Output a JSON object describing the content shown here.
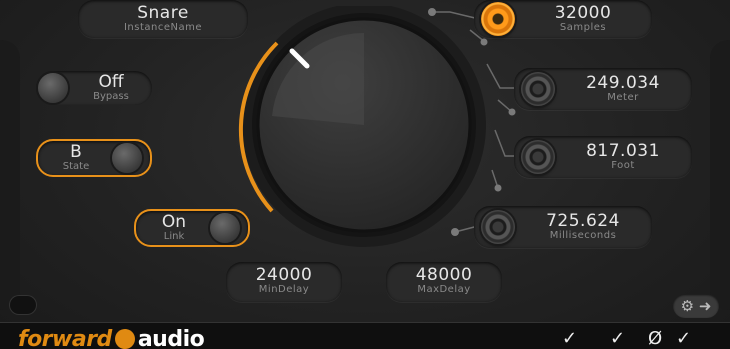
{
  "instance": {
    "value": "Snare",
    "label": "InstanceName"
  },
  "bypass": {
    "value": "Off",
    "label": "Bypass"
  },
  "state": {
    "value": "B",
    "label": "State"
  },
  "link": {
    "value": "On",
    "label": "Link"
  },
  "min_delay": {
    "value": "24000",
    "label": "MinDelay"
  },
  "max_delay": {
    "value": "48000",
    "label": "MaxDelay"
  },
  "samples": {
    "value": "32000",
    "label": "Samples"
  },
  "meter": {
    "value": "249.034",
    "label": "Meter"
  },
  "foot": {
    "value": "817.031",
    "label": "Foot"
  },
  "milliseconds": {
    "value": "725.624",
    "label": "Milliseconds"
  },
  "brand": {
    "part1": "forward",
    "part2": "audio"
  },
  "colors": {
    "accent": "#e8911a",
    "background": "#222222",
    "text": "#e6e6e6",
    "label": "#8a8a8a"
  },
  "icons": [
    "gear-icon",
    "arrow-right-icon",
    "check-icon",
    "knob-indicator"
  ]
}
